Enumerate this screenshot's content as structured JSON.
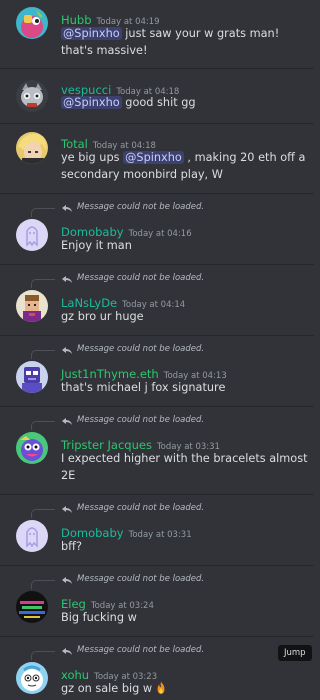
{
  "jump_label": "Jump",
  "reply_placeholder": "Message could not be loaded.",
  "colors": {
    "background": "#313338",
    "green_author": "#2dc770",
    "teal_author": "#1abc9c",
    "text": "#dbdee1",
    "muted": "#949ba4",
    "mention_bg": "#3c4270",
    "mention_fg": "#c9cdfb"
  },
  "messages": [
    {
      "author": "Hubb",
      "time": "Today at 04:19",
      "mention": "@Spinxho",
      "text_before": "",
      "text_after": " just saw your w grats man! that's massive!",
      "reply": false,
      "avatar": "teal-pink-character-avatar"
    },
    {
      "author": "vespucci",
      "time": "Today at 04:18",
      "mention": "@Spinxho",
      "text_before": "",
      "text_after": " good shit gg",
      "reply": false,
      "avatar": "grey-cat-avatar"
    },
    {
      "author": "Total",
      "time": "Today at 04:18",
      "mention": "@Spinxho",
      "text_before": "ye big ups ",
      "text_after": " , making 20 eth off a secondary moonbird play, W",
      "reply": false,
      "avatar": "blonde-anime-avatar"
    },
    {
      "author": "Domobaby",
      "time": "Today at 04:16",
      "text": "Enjoy it man",
      "reply": true,
      "avatar": "lavender-ghost-avatar"
    },
    {
      "author": "LaNsLyDe",
      "time": "Today at 04:14",
      "text": "gz bro ur huge",
      "reply": true,
      "avatar": "pixel-character-avatar"
    },
    {
      "author": "Just1nThyme.eth",
      "time": "Today at 04:13",
      "text": "that's michael j fox signature",
      "reply": true,
      "avatar": "purple-robot-avatar"
    },
    {
      "author": "Tripster Jacques",
      "time": "Today at 03:31",
      "text": "I expected higher with the bracelets almost 2E",
      "reply": true,
      "avatar": "rainbow-creature-avatar"
    },
    {
      "author": "Domobaby",
      "time": "Today at 03:31",
      "text": "bff?",
      "reply": true,
      "avatar": "lavender-ghost-avatar"
    },
    {
      "author": "Eleg",
      "time": "Today at 03:24",
      "text": "Big fucking w",
      "reply": true,
      "avatar": "dark-glitch-avatar"
    },
    {
      "author": "xohu",
      "time": "Today at 03:23",
      "text": "gz on sale big w",
      "reply": true,
      "avatar": "blue-cartoon-avatar",
      "emoji": "fire-emoji"
    }
  ]
}
